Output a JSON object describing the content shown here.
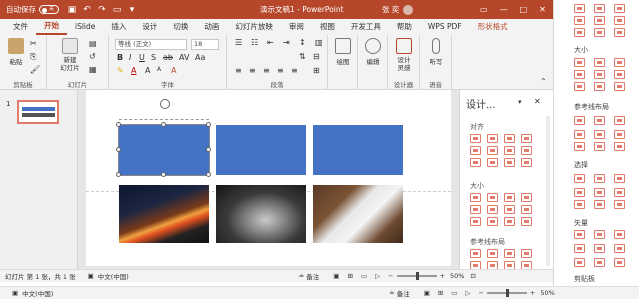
{
  "titlebar": {
    "autosave_label": "自动保存",
    "autosave_state": "关",
    "doc_title": "演示文稿1 - PowerPoint",
    "user_name": "张 奕",
    "icons": [
      "save-icon",
      "undo-icon",
      "redo-icon",
      "present-icon",
      "customize-icon"
    ]
  },
  "tabs": [
    {
      "label": "文件"
    },
    {
      "label": "开始",
      "active": true
    },
    {
      "label": "iSlide"
    },
    {
      "label": "插入"
    },
    {
      "label": "设计"
    },
    {
      "label": "切换"
    },
    {
      "label": "动画"
    },
    {
      "label": "幻灯片放映"
    },
    {
      "label": "审阅"
    },
    {
      "label": "视图"
    },
    {
      "label": "开发工具"
    },
    {
      "label": "帮助"
    },
    {
      "label": "WPS PDF"
    },
    {
      "label": "形状格式",
      "accent": true
    }
  ],
  "ribbon": {
    "paste": "粘贴",
    "clipboard": "剪贴板",
    "new_slide": "新建\n幻灯片",
    "slides": "幻灯片",
    "font_name": "等线 (正文)",
    "font_size": "18",
    "font": "字体",
    "paragraph": "段落",
    "drawing": "绘图",
    "editing": "编辑",
    "designer": "设计\n灵感",
    "designer_group": "设计器",
    "dictate": "听写",
    "voice": "语音"
  },
  "thumbs": {
    "number": "1"
  },
  "design_pane": {
    "title": "设计...",
    "align": "对齐",
    "size": "大小",
    "guides": "参考线布局"
  },
  "right_panel": {
    "size": "大小",
    "guides": "参考线布局",
    "select": "选择",
    "vector": "矢量",
    "clipboard": "剪贴板"
  },
  "status": {
    "slide_info": "幻灯片 第 1 张，共 1 张",
    "language": "中文(中国)",
    "notes": "备注",
    "zoom": "50%"
  },
  "bottombar": {
    "language": "中文(中国)",
    "notes": "备注",
    "zoom": "50%"
  },
  "colors": {
    "accent": "#b7472a",
    "shape_fill": "#4472c4"
  }
}
